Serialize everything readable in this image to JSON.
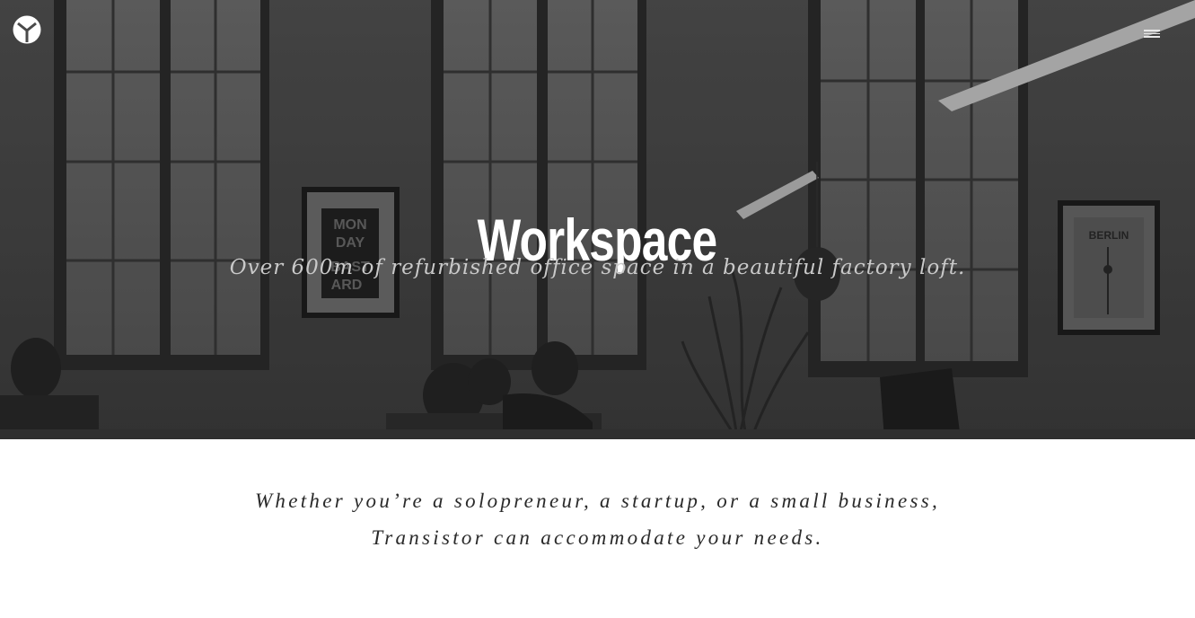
{
  "header": {
    "logo_icon": "transistor-logo-icon",
    "menu_icon": "hamburger-menu-icon"
  },
  "hero": {
    "title": "Workspace",
    "subtitle": "Over 600m of refurbished office space in a beautiful factory loft.",
    "poster_left_text": "MON DAY BAST ARD",
    "poster_right_text": "BERLIN"
  },
  "intro": {
    "line1": "Whether you’re a solopreneur, a startup, or a small business,",
    "line2": "Transistor can accommodate your needs."
  },
  "colors": {
    "hero_overlay": "#4a4a4a",
    "text_light": "#ffffff",
    "text_dark": "#2a2a2a"
  }
}
